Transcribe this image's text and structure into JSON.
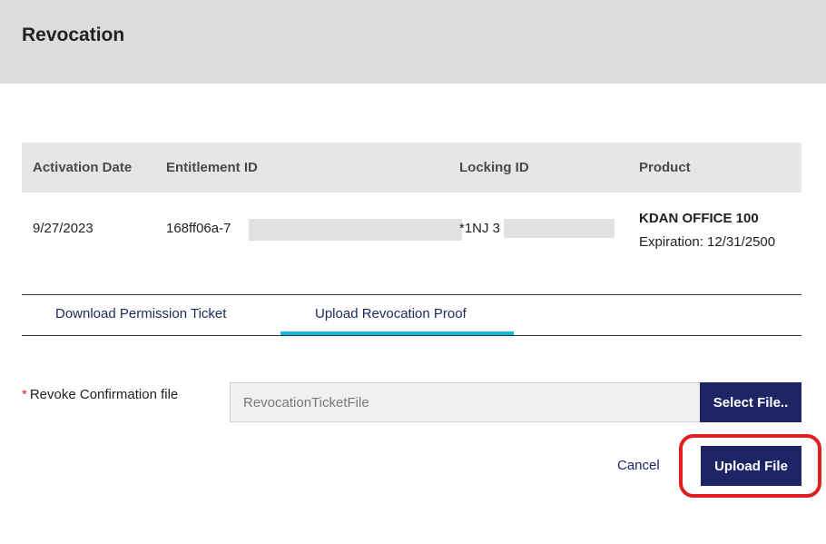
{
  "dialog": {
    "title": "Revocation"
  },
  "table": {
    "headers": [
      "Activation Date",
      "Entitlement ID",
      "Locking ID",
      "Product"
    ],
    "row": {
      "activation_date": "9/27/2023",
      "entitlement_id": "168ff06a-7",
      "locking_id": "*1NJ 3",
      "product_name": "KDAN OFFICE 100",
      "expiration": "Expiration: 12/31/2500"
    }
  },
  "tabs": [
    {
      "label": "Download Permission Ticket",
      "active": false
    },
    {
      "label": "Upload Revocation Proof",
      "active": true
    }
  ],
  "form": {
    "required_marker": "*",
    "file_label": "Revoke Confirmation file",
    "file_value": "RevocationTicketFile",
    "select_button": "Select File.."
  },
  "actions": {
    "cancel": "Cancel",
    "upload": "Upload File"
  },
  "colors": {
    "header_bg": "#dcdcdc",
    "primary": "#1d2567",
    "tab_indicator": "#10b7df",
    "highlight": "#e02020"
  }
}
